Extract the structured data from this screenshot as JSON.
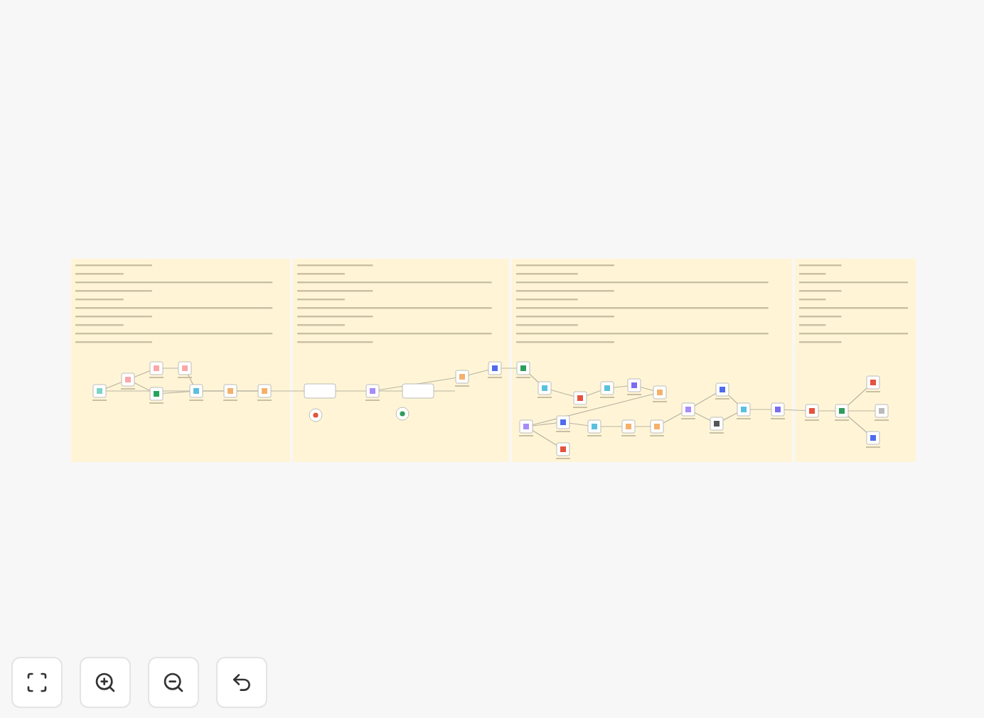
{
  "toolbar": [
    {
      "kind": "fit"
    },
    {
      "kind": "zoom_in"
    },
    {
      "kind": "zoom_out"
    },
    {
      "kind": "reset"
    }
  ]
}
